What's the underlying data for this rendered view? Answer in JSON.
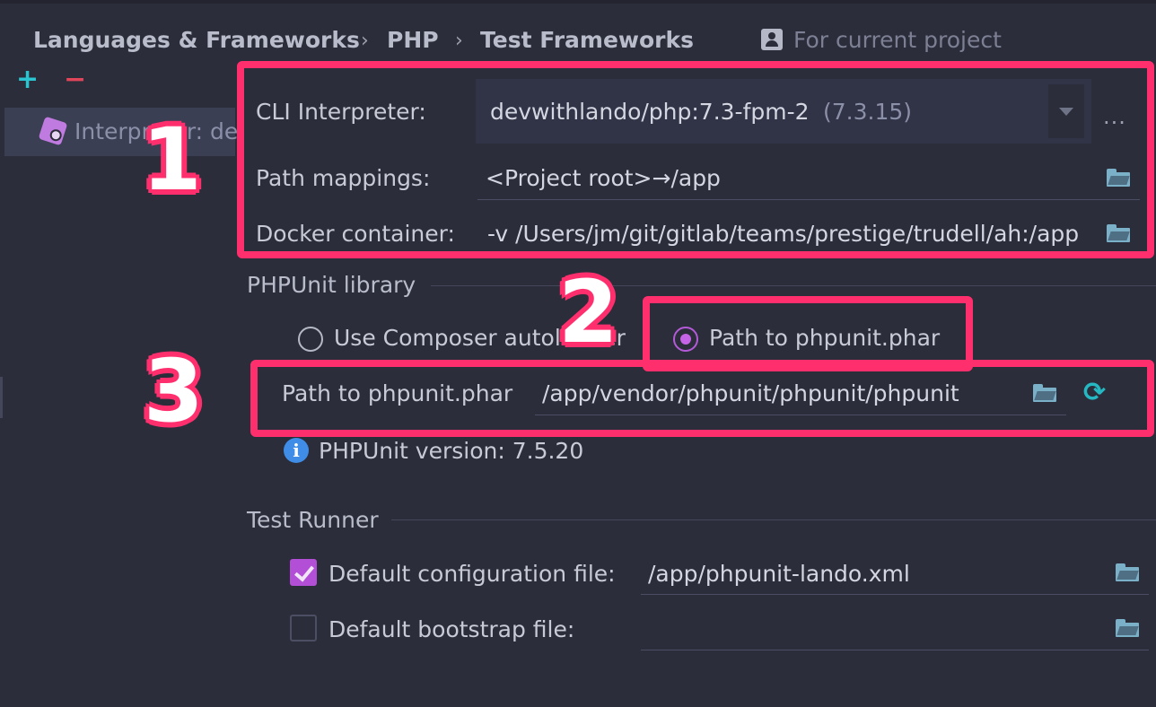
{
  "breadcrumb": {
    "items": [
      "Languages & Frameworks",
      "PHP",
      "Test Frameworks"
    ],
    "separator": "›",
    "scope_label": "For current project",
    "scope_icon": "project-scope-icon"
  },
  "sidebar": {
    "add_label": "+",
    "remove_label": "−",
    "items": [
      {
        "label": "Interpreter: de",
        "icon": "php-interpreter-icon"
      }
    ]
  },
  "interpreter": {
    "cli_label": "CLI Interpreter:",
    "cli_value": "devwithlando/php:7.3-fpm-2",
    "cli_version": "(7.3.15)",
    "more_label": "...",
    "path_mappings_label": "Path mappings:",
    "path_mappings_value": "<Project root>→/app",
    "docker_label": "Docker container:",
    "docker_value": "-v /Users/jm/git/gitlab/teams/prestige/trudell/ah:/app"
  },
  "phpunit": {
    "section_title": "PHPUnit library",
    "option_composer": "Use Composer autoloader",
    "option_phar": "Path to phpunit.phar",
    "selected": "Path to phpunit.phar",
    "phar_label": "Path to phpunit.phar",
    "phar_value": "/app/vendor/phpunit/phpunit/phpunit",
    "version_text": "PHPUnit version: 7.5.20",
    "info_icon_glyph": "i"
  },
  "test_runner": {
    "section_title": "Test Runner",
    "default_config_label": "Default configuration file:",
    "default_config_checked": true,
    "default_config_value": "/app/phpunit-lando.xml",
    "default_bootstrap_label": "Default bootstrap file:",
    "default_bootstrap_checked": false,
    "default_bootstrap_value": ""
  },
  "annotations": {
    "labels": [
      "1",
      "2",
      "3"
    ],
    "color": "#ff2f6e"
  },
  "colors": {
    "background": "#2b2d3a",
    "accent_purple": "#b24fd6",
    "accent_teal": "#2ac5d0",
    "danger_red": "#e0455a",
    "info_blue": "#3f8de6"
  }
}
